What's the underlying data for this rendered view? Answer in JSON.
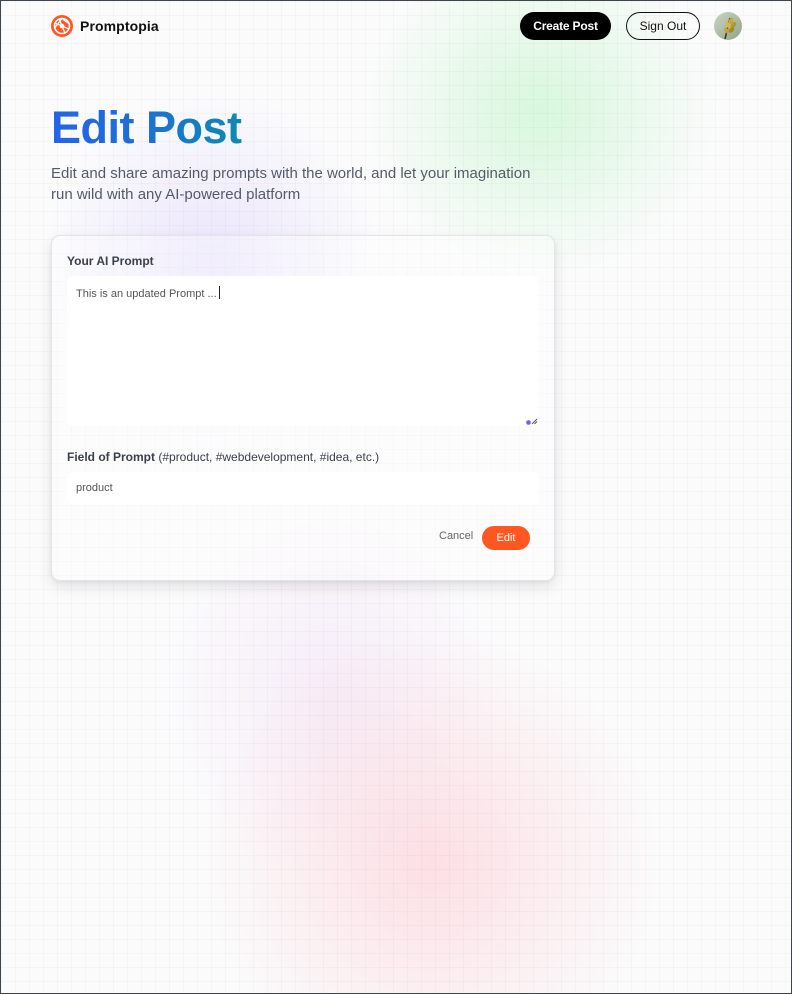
{
  "nav": {
    "logo_text": "Promptopia",
    "logo_icon": "globe-logo-icon",
    "create_post_label": "Create Post",
    "sign_out_label": "Sign Out",
    "avatar_icon": "profile-avatar"
  },
  "header": {
    "title": "Edit Post",
    "description": "Edit and share amazing prompts with the world, and let your imagination run wild with any AI-powered platform"
  },
  "form": {
    "prompt_label": "Your AI Prompt",
    "prompt_value": "This is an updated Prompt ...",
    "tag_label": "Field of Prompt",
    "tag_hint": "(#product, #webdevelopment, #idea, etc.)",
    "tag_value": "product",
    "cancel_label": "Cancel",
    "submit_label": "Edit"
  },
  "colors": {
    "accent": "#ff5722",
    "title_gradient_start": "#2563eb",
    "title_gradient_end": "#0e8ab0",
    "primary_button": "#000000"
  }
}
